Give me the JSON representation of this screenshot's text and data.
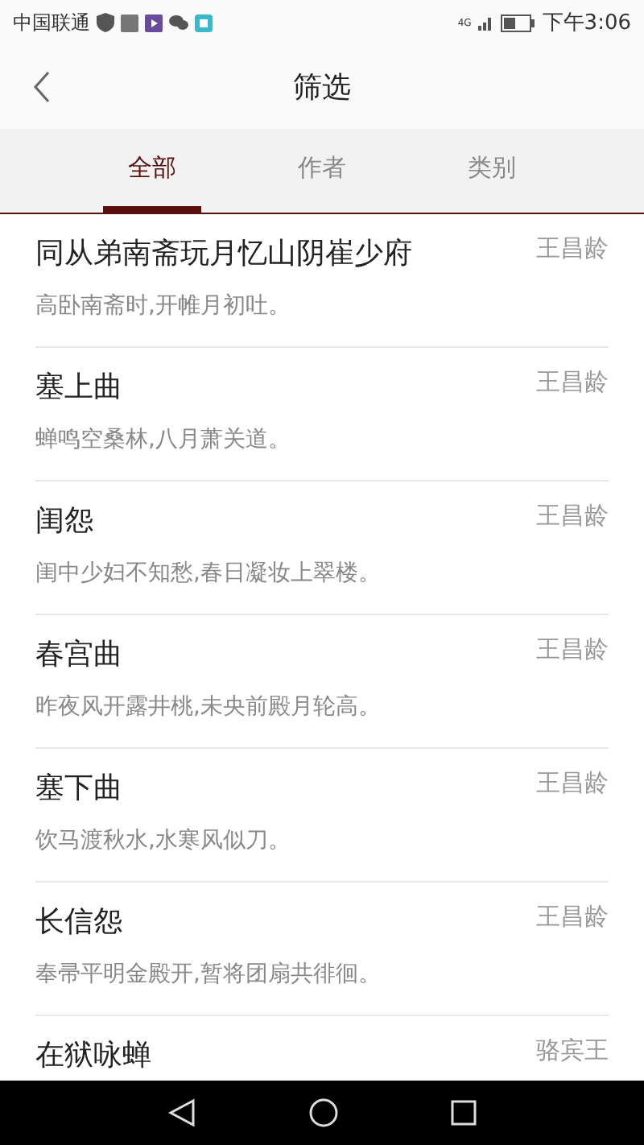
{
  "status_bar": {
    "carrier": "中国联通",
    "network": "4G",
    "time": "下午3:06"
  },
  "header": {
    "title": "筛选"
  },
  "tabs": [
    {
      "label": "全部",
      "selected": true
    },
    {
      "label": "作者",
      "selected": false
    },
    {
      "label": "类别",
      "selected": false
    }
  ],
  "poems": [
    {
      "title": "同从弟南斋玩月忆山阴崔少府",
      "author": "王昌龄",
      "line": "高卧南斋时,开帷月初吐。"
    },
    {
      "title": "塞上曲",
      "author": "王昌龄",
      "line": "蝉鸣空桑林,八月萧关道。"
    },
    {
      "title": "闺怨",
      "author": "王昌龄",
      "line": "闺中少妇不知愁,春日凝妆上翠楼。"
    },
    {
      "title": "春宫曲",
      "author": "王昌龄",
      "line": "昨夜风开露井桃,未央前殿月轮高。"
    },
    {
      "title": "塞下曲",
      "author": "王昌龄",
      "line": "饮马渡秋水,水寒风似刀。"
    },
    {
      "title": "长信怨",
      "author": "王昌龄",
      "line": "奉帚平明金殿开,暂将团扇共徘徊。"
    },
    {
      "title": "在狱咏蝉",
      "author": "骆宾王"
    }
  ]
}
